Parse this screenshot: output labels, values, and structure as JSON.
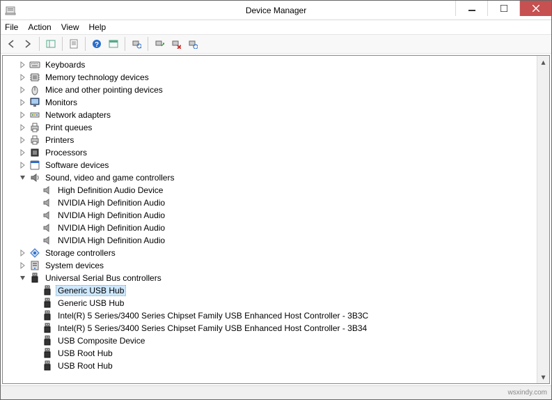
{
  "window": {
    "title": "Device Manager"
  },
  "menu": {
    "items": [
      "File",
      "Action",
      "View",
      "Help"
    ]
  },
  "watermark": "wsxindy.com",
  "tree": [
    {
      "icon": "keyboard",
      "label": "Keyboards",
      "depth": 1,
      "expander": "closed",
      "children": []
    },
    {
      "icon": "chip",
      "label": "Memory technology devices",
      "depth": 1,
      "expander": "closed",
      "children": []
    },
    {
      "icon": "mouse",
      "label": "Mice and other pointing devices",
      "depth": 1,
      "expander": "closed",
      "children": []
    },
    {
      "icon": "monitor",
      "label": "Monitors",
      "depth": 1,
      "expander": "closed",
      "children": []
    },
    {
      "icon": "network",
      "label": "Network adapters",
      "depth": 1,
      "expander": "closed",
      "children": []
    },
    {
      "icon": "printer",
      "label": "Print queues",
      "depth": 1,
      "expander": "closed",
      "children": []
    },
    {
      "icon": "printer",
      "label": "Printers",
      "depth": 1,
      "expander": "closed",
      "children": []
    },
    {
      "icon": "cpu",
      "label": "Processors",
      "depth": 1,
      "expander": "closed",
      "children": []
    },
    {
      "icon": "software",
      "label": "Software devices",
      "depth": 1,
      "expander": "closed",
      "children": []
    },
    {
      "icon": "sound",
      "label": "Sound, video and game controllers",
      "depth": 1,
      "expander": "open",
      "children": [
        {
          "icon": "speaker",
          "label": "High Definition Audio Device",
          "depth": 2
        },
        {
          "icon": "speaker",
          "label": "NVIDIA High Definition Audio",
          "depth": 2
        },
        {
          "icon": "speaker",
          "label": "NVIDIA High Definition Audio",
          "depth": 2
        },
        {
          "icon": "speaker",
          "label": "NVIDIA High Definition Audio",
          "depth": 2
        },
        {
          "icon": "speaker",
          "label": "NVIDIA High Definition Audio",
          "depth": 2
        }
      ]
    },
    {
      "icon": "storage",
      "label": "Storage controllers",
      "depth": 1,
      "expander": "closed",
      "children": []
    },
    {
      "icon": "system",
      "label": "System devices",
      "depth": 1,
      "expander": "closed",
      "children": []
    },
    {
      "icon": "usb",
      "label": "Universal Serial Bus controllers",
      "depth": 1,
      "expander": "open",
      "children": [
        {
          "icon": "usb",
          "label": "Generic USB Hub",
          "depth": 2,
          "selected": true
        },
        {
          "icon": "usb",
          "label": "Generic USB Hub",
          "depth": 2
        },
        {
          "icon": "usb",
          "label": "Intel(R) 5 Series/3400 Series Chipset Family USB Enhanced Host Controller - 3B3C",
          "depth": 2
        },
        {
          "icon": "usb",
          "label": "Intel(R) 5 Series/3400 Series Chipset Family USB Enhanced Host Controller - 3B34",
          "depth": 2
        },
        {
          "icon": "usb",
          "label": "USB Composite Device",
          "depth": 2
        },
        {
          "icon": "usb",
          "label": "USB Root Hub",
          "depth": 2
        },
        {
          "icon": "usb",
          "label": "USB Root Hub",
          "depth": 2
        }
      ]
    }
  ]
}
